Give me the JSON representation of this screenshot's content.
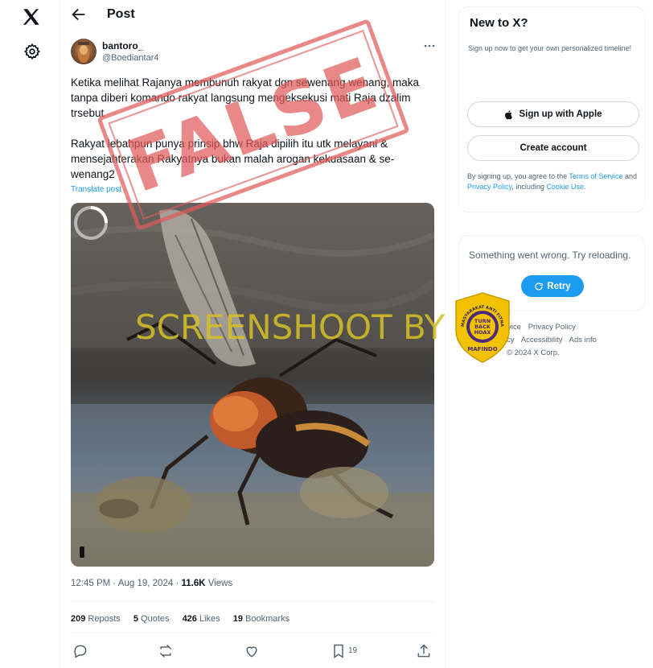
{
  "nav": {
    "logo_icon": "x-logo-icon",
    "settings_icon": "gear-icon"
  },
  "header": {
    "title": "Post"
  },
  "tweet": {
    "author_name": "bantoro_",
    "author_handle": "@Boediantar4",
    "paragraph_1": "Ketika melihat Rajanya membunuh rakyat dgn sewenang wenang, maka tanpa diberi komando rakyat langsung mengeksekusi mati Raja dzalim trsebut",
    "paragraph_2": "Rakyat lebahpun punya prinsip bhw Raja dipilih itu utk melayani & mensejahterakan Rakyatnya bukan malah arogan kekuasaan & se-wenang2",
    "translate_label": "Translate post",
    "time": "12:45 PM · Aug 19, 2024",
    "views_count": "11.6K",
    "views_label": " Views",
    "stats": {
      "reposts_count": "209",
      "reposts_label": "Reposts",
      "quotes_count": "5",
      "quotes_label": "Quotes",
      "likes_count": "426",
      "likes_label": "Likes",
      "bookmarks_count": "19",
      "bookmarks_label": "Bookmarks"
    },
    "bookmark_action_count": "19"
  },
  "overlays": {
    "stamp_text": "FALSE",
    "watermark_text": "SCREENSHOOT BY",
    "badge": {
      "arc_text": "MASYARAKAT ANTI FITNAH INDONESIA",
      "line1": "TURN",
      "line2": "BACK",
      "line3": "HOAX",
      "brand": "MAFINDO"
    }
  },
  "sidebar": {
    "signup": {
      "title": "New to X?",
      "desc": "Sign up now to get your own personalized timeline!",
      "apple_label": "Sign up with Apple",
      "create_label": "Create account",
      "legal_prefix": "By signing up, you agree to the ",
      "terms_link": "Terms of Service",
      "legal_and": " and ",
      "privacy_link": "Privacy Policy",
      "legal_including": ", including ",
      "cookie_link": "Cookie Use",
      "legal_end": "."
    },
    "error": {
      "message": "Something went wrong. Try reloading.",
      "retry_label": "Retry"
    },
    "footer": {
      "line1_a": "rvice",
      "line1_b": "Privacy Policy",
      "line2_a": "icy",
      "line2_b": "Accessibility",
      "line2_c": "Ads info",
      "copyright": "© 2024 X Corp."
    }
  },
  "colors": {
    "accent": "#1d9bf0",
    "stamp": "#e05a5a",
    "watermark": "#d6be28",
    "badge_bg": "#f2c200",
    "badge_ring": "#4a2a7a"
  }
}
